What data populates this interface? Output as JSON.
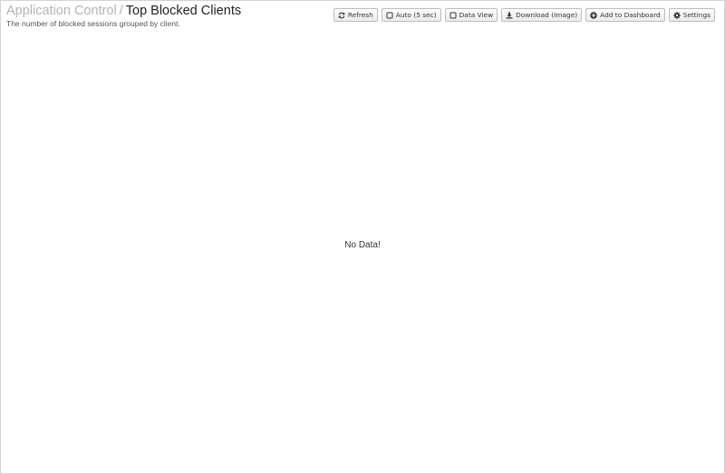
{
  "header": {
    "breadcrumb_parent": "Application Control",
    "breadcrumb_separator": "/",
    "title": "Top Blocked Clients",
    "subtitle": "The number of blocked sessions grouped by client."
  },
  "toolbar": {
    "refresh_label": "Refresh",
    "auto_label": "Auto (5 sec)",
    "data_view_label": "Data View",
    "download_label": "Download (Image)",
    "add_dashboard_label": "Add to Dashboard",
    "settings_label": "Settings",
    "icons": {
      "refresh": "refresh-icon",
      "auto": "checkbox-unchecked-icon",
      "data_view": "checkbox-unchecked-icon",
      "download": "download-icon",
      "add_dashboard": "plus-circle-icon",
      "settings": "gear-icon"
    }
  },
  "content": {
    "empty_message": "No Data!"
  }
}
